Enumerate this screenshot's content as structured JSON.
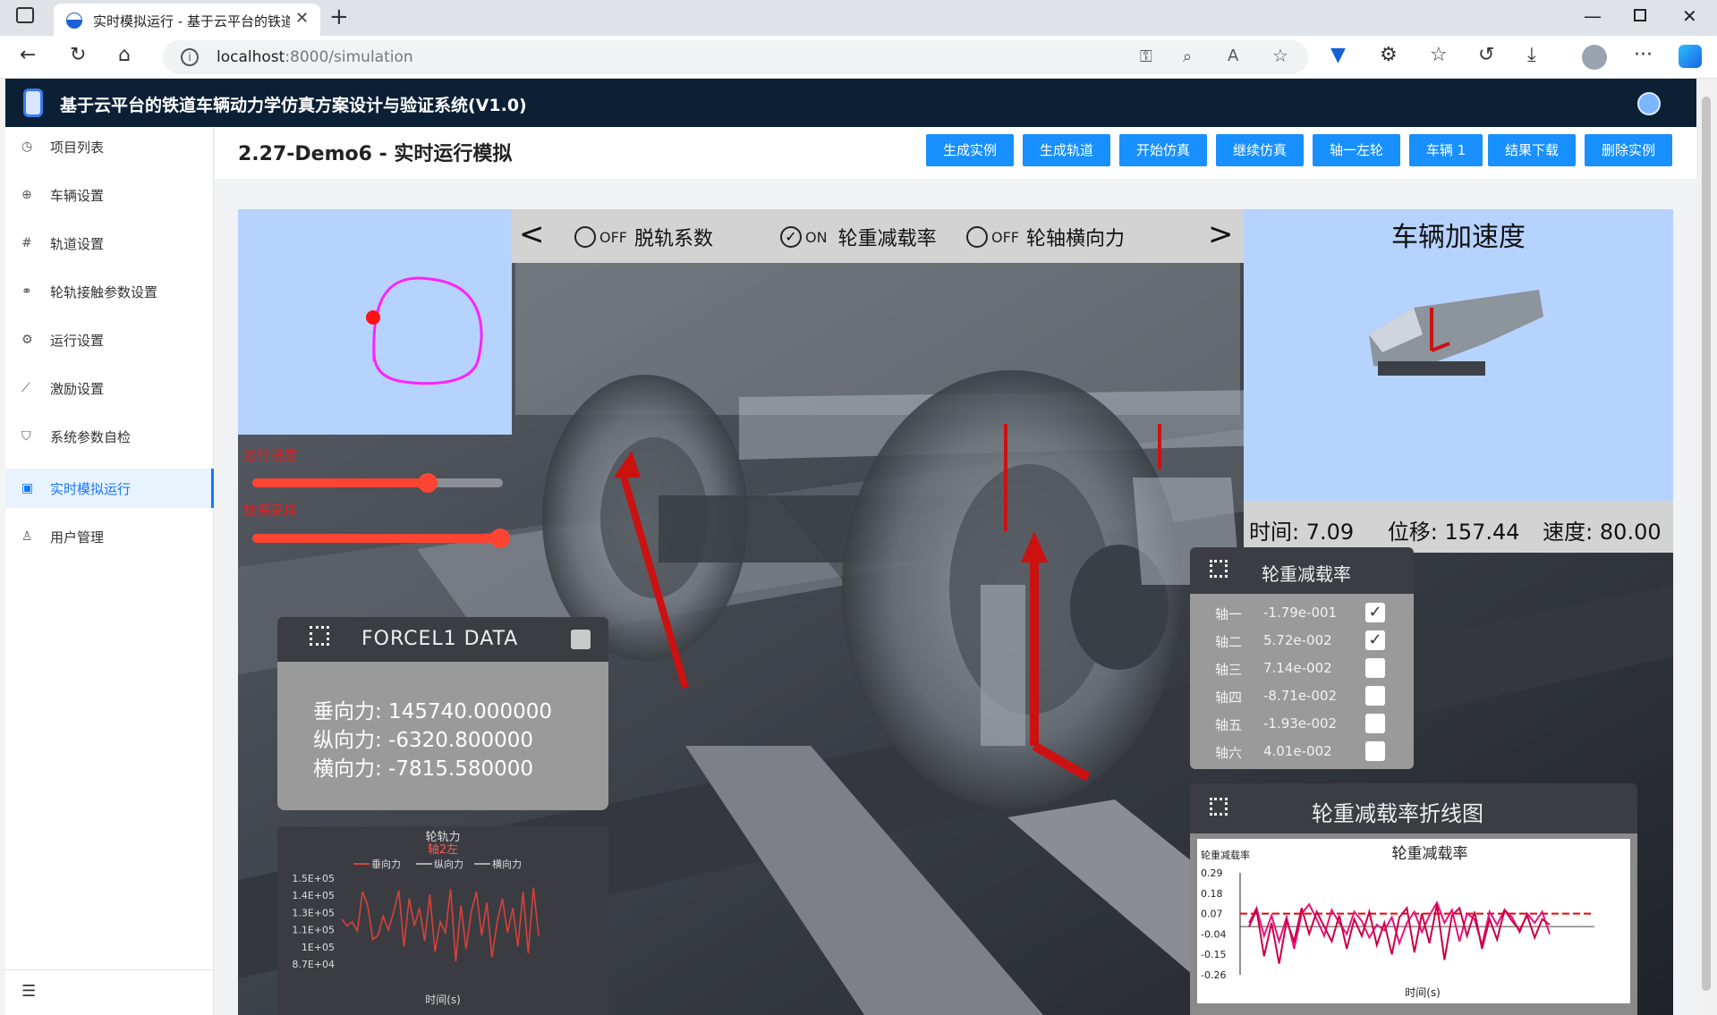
{
  "browser": {
    "tab_title": "实时模拟运行 - 基于云平台的铁道车辆动力学仿真",
    "url_host": "localhost",
    "url_rest": ":8000/simulation",
    "new_tab": "+"
  },
  "app": {
    "title": "基于云平台的铁道车辆动力学仿真方案设计与验证系统(V1.0)"
  },
  "sidebar": {
    "items": [
      {
        "label": "项目列表",
        "icon": "clock-icon"
      },
      {
        "label": "车辆设置",
        "icon": "globe-icon"
      },
      {
        "label": "轨道设置",
        "icon": "hash-icon"
      },
      {
        "label": "轮轨接触参数设置",
        "icon": "link-icon"
      },
      {
        "label": "运行设置",
        "icon": "gear-icon"
      },
      {
        "label": "激励设置",
        "icon": "chart-line-icon"
      },
      {
        "label": "系统参数自检",
        "icon": "shield-icon"
      },
      {
        "label": "实时模拟运行",
        "icon": "monitor-icon"
      },
      {
        "label": "用户管理",
        "icon": "user-icon"
      }
    ],
    "active_index": 7
  },
  "page": {
    "title": "2.27-Demo6 - 实时运行模拟",
    "actions": [
      "生成实例",
      "生成轨道",
      "开始仿真",
      "继续仿真",
      "轴一左轮",
      "车辆 1",
      "结果下载",
      "删除实例"
    ]
  },
  "scene": {
    "toggles": [
      {
        "state": "OFF",
        "label": "脱轨系数"
      },
      {
        "state": "ON",
        "label": "轮重减载率"
      },
      {
        "state": "OFF",
        "label": "轮轴横向力"
      }
    ],
    "run_progress_label": "运行进度",
    "run_progress": 0.7,
    "speed_label": "数据采样",
    "speed_value": 0.99,
    "accel_panel": {
      "title": "车辆加速度",
      "time_label": "时间:",
      "time_value": "7.09",
      "disp_label": "位移:",
      "disp_value": "157.44",
      "speed_label": "速度:",
      "speed_value": "80.00"
    },
    "force_panel": {
      "title": "FORCEL1 DATA",
      "lines": [
        "垂向力: 145740.000000",
        "纵向力: -6320.800000",
        "横向力: -7815.580000"
      ]
    },
    "reduction_panel": {
      "title": "轮重减载率",
      "rows": [
        {
          "axle": "轴一",
          "value": "-1.79e-001",
          "checked": true
        },
        {
          "axle": "轴二",
          "value": "5.72e-002",
          "checked": true
        },
        {
          "axle": "轴三",
          "value": "7.14e-002",
          "checked": false
        },
        {
          "axle": "轴四",
          "value": "-8.71e-002",
          "checked": false
        },
        {
          "axle": "轴五",
          "value": "-1.93e-002",
          "checked": false
        },
        {
          "axle": "轴六",
          "value": "4.01e-002",
          "checked": false
        }
      ]
    },
    "line_panel_title": "轮重减载率折线图"
  },
  "chart_data": [
    {
      "type": "line",
      "title": "轮轨力",
      "subtitle": "轴2左",
      "xlabel": "时间(s)",
      "ylabel": "",
      "legend": [
        "垂向力",
        "纵向力",
        "横向力"
      ],
      "yticks": [
        "1.5E+05",
        "1.4E+05",
        "1.3E+05",
        "1.1E+05",
        "1E+05",
        "8.7E+04"
      ],
      "ylim": [
        87000,
        150000
      ],
      "series": [
        {
          "name": "垂向力",
          "color": "#d9413c",
          "values": [
            120000,
            115000,
            118000,
            111000,
            140000,
            130000,
            105000,
            108000,
            122000,
            112000,
            125000,
            141000,
            100000,
            135000,
            115000,
            128000,
            104000,
            138000,
            96000,
            118000,
            110000,
            142000,
            89000,
            130000,
            98000,
            125000,
            140000,
            108000,
            132000,
            92000,
            118000,
            135000,
            110000,
            128000,
            100000,
            140000,
            95000,
            143000,
            108000
          ]
        }
      ]
    },
    {
      "type": "line",
      "title": "轮重减载率",
      "xlabel": "时间(s)",
      "ylabel": "轮重减载率",
      "yticks": [
        "0.29",
        "0.18",
        "0.07",
        "-0.04",
        "-0.15",
        "-0.26"
      ],
      "ylim": [
        -0.26,
        0.29
      ],
      "series": [
        {
          "name": "",
          "color": "#e8127c",
          "values": [
            0.02,
            0.1,
            -0.05,
            0.06,
            -0.08,
            0.05,
            -0.12,
            0.07,
            0.12,
            0.04,
            -0.05,
            0.09,
            0.02,
            -0.04,
            0.08,
            0.03,
            -0.06,
            0.01,
            -0.02,
            0.05,
            -0.09,
            0.02,
            0.08,
            -0.03,
            0.06,
            0.13,
            0.02,
            0.09,
            -0.08,
            0.07,
            0.04,
            -0.1,
            0.08,
            0.01,
            0.09,
            0.05,
            -0.03,
            0.07,
            0.02,
            0.08,
            -0.04
          ]
        },
        {
          "name": "",
          "color": "#cc0044",
          "values": [
            0.0,
            0.09,
            -0.16,
            0.02,
            -0.2,
            0.03,
            -0.08,
            0.1,
            -0.04,
            0.08,
            0.0,
            -0.08,
            0.06,
            -0.12,
            0.04,
            -0.05,
            0.08,
            -0.1,
            0.02,
            -0.15,
            0.05,
            0.1,
            -0.14,
            0.07,
            -0.09,
            0.12,
            -0.18,
            0.06,
            0.1,
            -0.05,
            0.08,
            -0.12,
            0.04,
            -0.07,
            0.09,
            0.03,
            -0.02,
            0.06,
            -0.06,
            0.04,
            0.01
          ]
        }
      ],
      "reference_lines": [
        0.07,
        0.0
      ]
    }
  ]
}
